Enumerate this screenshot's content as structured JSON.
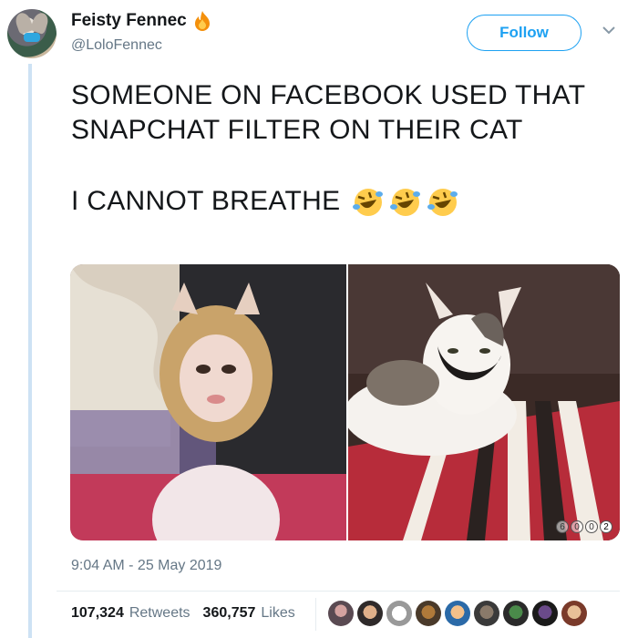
{
  "author": {
    "display_name": "Feisty Fennec",
    "handle": "@LoloFennec"
  },
  "follow_button": {
    "label": "Follow"
  },
  "tweet": {
    "line1": "SOMEONE ON FACEBOOK USED THAT SNAPCHAT FILTER ON THEIR CAT",
    "line2": "I CANNOT BREATHE"
  },
  "media": {
    "count_indicator": [
      "6",
      "0",
      "0",
      "2"
    ]
  },
  "timestamp": "9:04 AM - 25 May 2019",
  "stats": {
    "retweets_count": "107,324",
    "retweets_label": "Retweets",
    "likes_count": "360,757",
    "likes_label": "Likes"
  },
  "colors": {
    "accent": "#1da1f2",
    "secondary_text": "#657786",
    "thread_line": "#cde2f4"
  },
  "icons": {
    "fire": "fire-icon",
    "emoji": "rolling-on-floor-laughing-icon",
    "chevron": "chevron-down-icon"
  }
}
